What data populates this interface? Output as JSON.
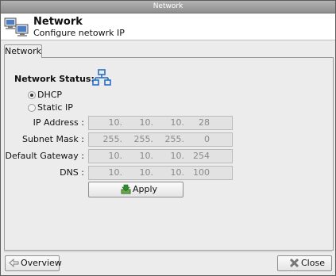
{
  "window": {
    "title": "Network"
  },
  "header": {
    "title": "Network",
    "subtitle": "Configure netowrk IP",
    "icon": "computers-network-icon"
  },
  "tabs": [
    {
      "label": "Network",
      "active": true
    }
  ],
  "status": {
    "label": "Network Status:",
    "icon": "network-topology-icon",
    "icon_color": "#2a6fc9"
  },
  "mode": {
    "options": [
      {
        "label": "DHCP",
        "selected": true
      },
      {
        "label": "Static IP",
        "selected": false
      }
    ]
  },
  "fields": [
    {
      "label": "IP Address :",
      "octets": [
        "10.",
        "10.",
        "10.",
        "28"
      ]
    },
    {
      "label": "Subnet Mask :",
      "octets": [
        "255.",
        "255.",
        "255.",
        "0"
      ]
    },
    {
      "label": "Default Gateway :",
      "octets": [
        "10.",
        "10.",
        "10.",
        "254"
      ]
    },
    {
      "label": "DNS :",
      "octets": [
        "10.",
        "10.",
        "10.",
        "100"
      ]
    }
  ],
  "buttons": {
    "apply": {
      "label": "Apply",
      "icon": "apply-download-icon"
    },
    "overview": {
      "label": "Overview",
      "icon": "arrow-left-icon"
    },
    "close": {
      "label": "Close",
      "icon": "close-x-icon"
    }
  }
}
